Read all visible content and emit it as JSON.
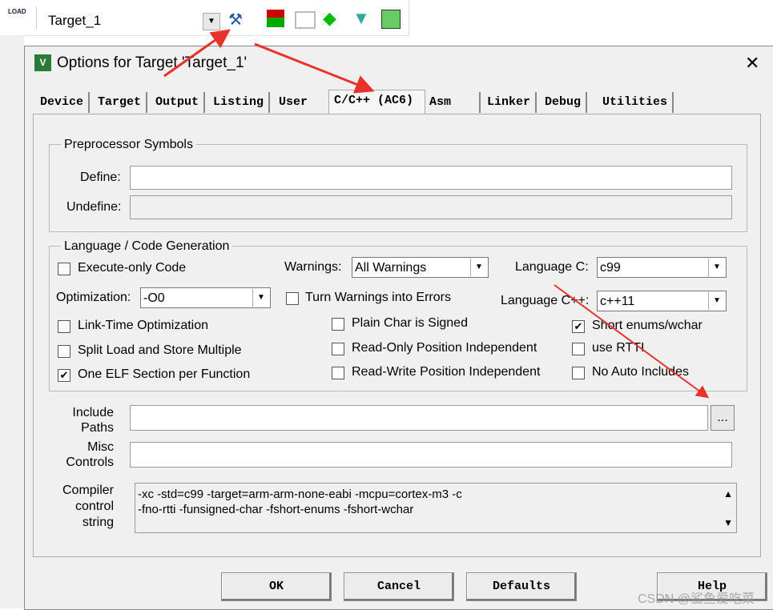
{
  "toolbar": {
    "load_label": "LOAD",
    "target": "Target_1"
  },
  "dialog": {
    "title": "Options for Target 'Target_1'"
  },
  "tabs": [
    "Device",
    "Target",
    "Output",
    "Listing",
    "User",
    "C/C++ (AC6)",
    "Asm",
    "Linker",
    "Debug",
    "Utilities"
  ],
  "preprocessor": {
    "group": "Preprocessor Symbols",
    "define_label": "Define:",
    "define_value": "",
    "undefine_label": "Undefine:",
    "undefine_value": ""
  },
  "language": {
    "group": "Language / Code Generation",
    "execute_only": "Execute-only Code",
    "warnings_label": "Warnings:",
    "warnings_value": "All Warnings",
    "language_c_label": "Language C:",
    "language_c_value": "c99",
    "optimization_label": "Optimization:",
    "optimization_value": "-O0",
    "turn_warnings": "Turn Warnings into Errors",
    "language_cpp_label": "Language C++:",
    "language_cpp_value": "c++11",
    "lto": "Link-Time Optimization",
    "plain_char": "Plain Char is Signed",
    "short_enums": "Short enums/wchar",
    "split_load": "Split Load and Store Multiple",
    "ro_pi": "Read-Only Position Independent",
    "use_rtti": "use RTTI",
    "one_elf": "One ELF Section per Function",
    "rw_pi": "Read-Write Position Independent",
    "no_auto": "No Auto Includes"
  },
  "include": {
    "label1": "Include",
    "label2": "Paths",
    "value": "",
    "browse": "..."
  },
  "misc": {
    "label1": "Misc",
    "label2": "Controls",
    "value": ""
  },
  "compiler": {
    "label1": "Compiler",
    "label2": "control",
    "label3": "string",
    "line1": "-xc -std=c99 -target=arm-arm-none-eabi -mcpu=cortex-m3 -c",
    "line2": "-fno-rtti -funsigned-char -fshort-enums -fshort-wchar"
  },
  "buttons": {
    "ok": "OK",
    "cancel": "Cancel",
    "defaults": "Defaults",
    "help": "Help"
  },
  "watermark": "CSDN @鲨鱼爱吃菜",
  "colors": {
    "arrow": "#e8322a"
  }
}
